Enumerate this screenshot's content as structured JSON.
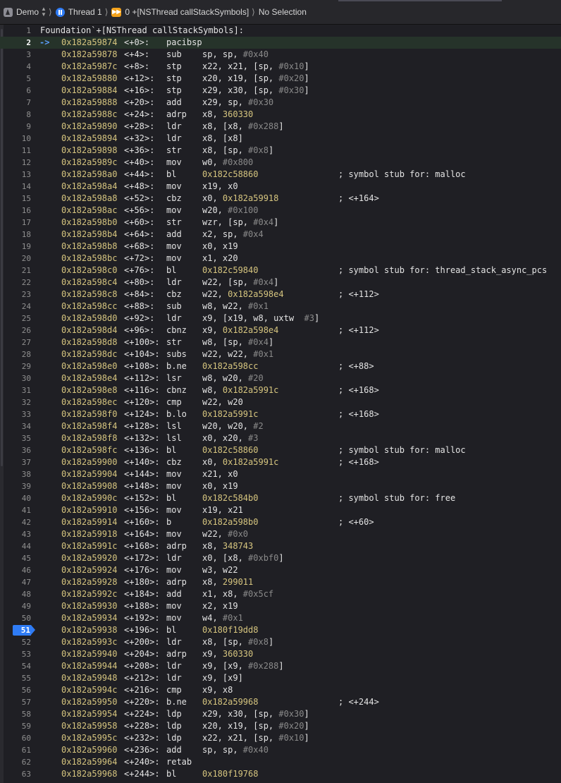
{
  "breadcrumb": {
    "app": "Demo",
    "thread": "Thread 1",
    "frame": "0 +[NSThread callStackSymbols]",
    "selection": "No Selection"
  },
  "disassembly": {
    "function_header": "Foundation`+[NSThread callStackSymbols]:",
    "pc_arrow": "->",
    "current_line": 2,
    "breakpoint_line": 51,
    "lines": [
      {
        "n": "1",
        "header": true
      },
      {
        "n": "2",
        "addr": "0x182a59874",
        "off": "<+0>:",
        "mn": "pacibsp",
        "ops": []
      },
      {
        "n": "3",
        "addr": "0x182a59878",
        "off": "<+4>:",
        "mn": "sub",
        "ops": [
          [
            "sp, sp, ",
            ""
          ],
          [
            "#0x40",
            "imm"
          ]
        ]
      },
      {
        "n": "4",
        "addr": "0x182a5987c",
        "off": "<+8>:",
        "mn": "stp",
        "ops": [
          [
            "x22, x21, [sp, ",
            ""
          ],
          [
            "#0x10",
            "imm"
          ],
          [
            "]",
            ""
          ]
        ]
      },
      {
        "n": "5",
        "addr": "0x182a59880",
        "off": "<+12>:",
        "mn": "stp",
        "ops": [
          [
            "x20, x19, [sp, ",
            ""
          ],
          [
            "#0x20",
            "imm"
          ],
          [
            "]",
            ""
          ]
        ]
      },
      {
        "n": "6",
        "addr": "0x182a59884",
        "off": "<+16>:",
        "mn": "stp",
        "ops": [
          [
            "x29, x30, [sp, ",
            ""
          ],
          [
            "#0x30",
            "imm"
          ],
          [
            "]",
            ""
          ]
        ]
      },
      {
        "n": "7",
        "addr": "0x182a59888",
        "off": "<+20>:",
        "mn": "add",
        "ops": [
          [
            "x29, sp, ",
            ""
          ],
          [
            "#0x30",
            "imm"
          ]
        ]
      },
      {
        "n": "8",
        "addr": "0x182a5988c",
        "off": "<+24>:",
        "mn": "adrp",
        "ops": [
          [
            "x8, ",
            ""
          ],
          [
            "360330",
            "sym"
          ]
        ]
      },
      {
        "n": "9",
        "addr": "0x182a59890",
        "off": "<+28>:",
        "mn": "ldr",
        "ops": [
          [
            "x8, [x8, ",
            ""
          ],
          [
            "#0x288",
            "imm"
          ],
          [
            "]",
            ""
          ]
        ]
      },
      {
        "n": "10",
        "addr": "0x182a59894",
        "off": "<+32>:",
        "mn": "ldr",
        "ops": [
          [
            "x8, [x8]",
            ""
          ]
        ]
      },
      {
        "n": "11",
        "addr": "0x182a59898",
        "off": "<+36>:",
        "mn": "str",
        "ops": [
          [
            "x8, [sp, ",
            ""
          ],
          [
            "#0x8",
            "imm"
          ],
          [
            "]",
            ""
          ]
        ]
      },
      {
        "n": "12",
        "addr": "0x182a5989c",
        "off": "<+40>:",
        "mn": "mov",
        "ops": [
          [
            "w0, ",
            ""
          ],
          [
            "#0x800",
            "imm"
          ]
        ]
      },
      {
        "n": "13",
        "addr": "0x182a598a0",
        "off": "<+44>:",
        "mn": "bl",
        "ops": [
          [
            "0x182c58860",
            "sym"
          ]
        ],
        "cm": "; symbol stub for: malloc"
      },
      {
        "n": "14",
        "addr": "0x182a598a4",
        "off": "<+48>:",
        "mn": "mov",
        "ops": [
          [
            "x19, x0",
            ""
          ]
        ]
      },
      {
        "n": "15",
        "addr": "0x182a598a8",
        "off": "<+52>:",
        "mn": "cbz",
        "ops": [
          [
            "x0, ",
            ""
          ],
          [
            "0x182a59918",
            "sym"
          ]
        ],
        "cm": "; <+164>"
      },
      {
        "n": "16",
        "addr": "0x182a598ac",
        "off": "<+56>:",
        "mn": "mov",
        "ops": [
          [
            "w20, ",
            ""
          ],
          [
            "#0x100",
            "imm"
          ]
        ]
      },
      {
        "n": "17",
        "addr": "0x182a598b0",
        "off": "<+60>:",
        "mn": "str",
        "ops": [
          [
            "wzr, [sp, ",
            ""
          ],
          [
            "#0x4",
            "imm"
          ],
          [
            "]",
            ""
          ]
        ]
      },
      {
        "n": "18",
        "addr": "0x182a598b4",
        "off": "<+64>:",
        "mn": "add",
        "ops": [
          [
            "x2, sp, ",
            ""
          ],
          [
            "#0x4",
            "imm"
          ]
        ]
      },
      {
        "n": "19",
        "addr": "0x182a598b8",
        "off": "<+68>:",
        "mn": "mov",
        "ops": [
          [
            "x0, x19",
            ""
          ]
        ]
      },
      {
        "n": "20",
        "addr": "0x182a598bc",
        "off": "<+72>:",
        "mn": "mov",
        "ops": [
          [
            "x1, x20",
            ""
          ]
        ]
      },
      {
        "n": "21",
        "addr": "0x182a598c0",
        "off": "<+76>:",
        "mn": "bl",
        "ops": [
          [
            "0x182c59840",
            "sym"
          ]
        ],
        "cm": "; symbol stub for: thread_stack_async_pcs"
      },
      {
        "n": "22",
        "addr": "0x182a598c4",
        "off": "<+80>:",
        "mn": "ldr",
        "ops": [
          [
            "w22, [sp, ",
            ""
          ],
          [
            "#0x4",
            "imm"
          ],
          [
            "]",
            ""
          ]
        ]
      },
      {
        "n": "23",
        "addr": "0x182a598c8",
        "off": "<+84>:",
        "mn": "cbz",
        "ops": [
          [
            "w22, ",
            ""
          ],
          [
            "0x182a598e4",
            "sym"
          ]
        ],
        "cm": "; <+112>"
      },
      {
        "n": "24",
        "addr": "0x182a598cc",
        "off": "<+88>:",
        "mn": "sub",
        "ops": [
          [
            "w8, w22, ",
            ""
          ],
          [
            "#0x1",
            "imm"
          ]
        ]
      },
      {
        "n": "25",
        "addr": "0x182a598d0",
        "off": "<+92>:",
        "mn": "ldr",
        "ops": [
          [
            "x9, [x19, w8, uxtw  ",
            ""
          ],
          [
            "#3",
            "imm"
          ],
          [
            "]",
            ""
          ]
        ]
      },
      {
        "n": "26",
        "addr": "0x182a598d4",
        "off": "<+96>:",
        "mn": "cbnz",
        "ops": [
          [
            "x9, ",
            ""
          ],
          [
            "0x182a598e4",
            "sym"
          ]
        ],
        "cm": "; <+112>"
      },
      {
        "n": "27",
        "addr": "0x182a598d8",
        "off": "<+100>:",
        "mn": "str",
        "ops": [
          [
            "w8, [sp, ",
            ""
          ],
          [
            "#0x4",
            "imm"
          ],
          [
            "]",
            ""
          ]
        ]
      },
      {
        "n": "28",
        "addr": "0x182a598dc",
        "off": "<+104>:",
        "mn": "subs",
        "ops": [
          [
            "w22, w22, ",
            ""
          ],
          [
            "#0x1",
            "imm"
          ]
        ]
      },
      {
        "n": "29",
        "addr": "0x182a598e0",
        "off": "<+108>:",
        "mn": "b.ne",
        "ops": [
          [
            "0x182a598cc",
            "sym"
          ]
        ],
        "cm": "; <+88>"
      },
      {
        "n": "30",
        "addr": "0x182a598e4",
        "off": "<+112>:",
        "mn": "lsr",
        "ops": [
          [
            "w8, w20, ",
            ""
          ],
          [
            "#20",
            "imm"
          ]
        ]
      },
      {
        "n": "31",
        "addr": "0x182a598e8",
        "off": "<+116>:",
        "mn": "cbnz",
        "ops": [
          [
            "w8, ",
            ""
          ],
          [
            "0x182a5991c",
            "sym"
          ]
        ],
        "cm": "; <+168>"
      },
      {
        "n": "32",
        "addr": "0x182a598ec",
        "off": "<+120>:",
        "mn": "cmp",
        "ops": [
          [
            "w22, w20",
            ""
          ]
        ]
      },
      {
        "n": "33",
        "addr": "0x182a598f0",
        "off": "<+124>:",
        "mn": "b.lo",
        "ops": [
          [
            "0x182a5991c",
            "sym"
          ]
        ],
        "cm": "; <+168>"
      },
      {
        "n": "34",
        "addr": "0x182a598f4",
        "off": "<+128>:",
        "mn": "lsl",
        "ops": [
          [
            "w20, w20, ",
            ""
          ],
          [
            "#2",
            "imm"
          ]
        ]
      },
      {
        "n": "35",
        "addr": "0x182a598f8",
        "off": "<+132>:",
        "mn": "lsl",
        "ops": [
          [
            "x0, x20, ",
            ""
          ],
          [
            "#3",
            "imm"
          ]
        ]
      },
      {
        "n": "36",
        "addr": "0x182a598fc",
        "off": "<+136>:",
        "mn": "bl",
        "ops": [
          [
            "0x182c58860",
            "sym"
          ]
        ],
        "cm": "; symbol stub for: malloc"
      },
      {
        "n": "37",
        "addr": "0x182a59900",
        "off": "<+140>:",
        "mn": "cbz",
        "ops": [
          [
            "x0, ",
            ""
          ],
          [
            "0x182a5991c",
            "sym"
          ]
        ],
        "cm": "; <+168>"
      },
      {
        "n": "38",
        "addr": "0x182a59904",
        "off": "<+144>:",
        "mn": "mov",
        "ops": [
          [
            "x21, x0",
            ""
          ]
        ]
      },
      {
        "n": "39",
        "addr": "0x182a59908",
        "off": "<+148>:",
        "mn": "mov",
        "ops": [
          [
            "x0, x19",
            ""
          ]
        ]
      },
      {
        "n": "40",
        "addr": "0x182a5990c",
        "off": "<+152>:",
        "mn": "bl",
        "ops": [
          [
            "0x182c584b0",
            "sym"
          ]
        ],
        "cm": "; symbol stub for: free"
      },
      {
        "n": "41",
        "addr": "0x182a59910",
        "off": "<+156>:",
        "mn": "mov",
        "ops": [
          [
            "x19, x21",
            ""
          ]
        ]
      },
      {
        "n": "42",
        "addr": "0x182a59914",
        "off": "<+160>:",
        "mn": "b",
        "ops": [
          [
            "0x182a598b0",
            "sym"
          ]
        ],
        "cm": "; <+60>"
      },
      {
        "n": "43",
        "addr": "0x182a59918",
        "off": "<+164>:",
        "mn": "mov",
        "ops": [
          [
            "w22, ",
            ""
          ],
          [
            "#0x0",
            "imm"
          ]
        ]
      },
      {
        "n": "44",
        "addr": "0x182a5991c",
        "off": "<+168>:",
        "mn": "adrp",
        "ops": [
          [
            "x8, ",
            ""
          ],
          [
            "348743",
            "sym"
          ]
        ]
      },
      {
        "n": "45",
        "addr": "0x182a59920",
        "off": "<+172>:",
        "mn": "ldr",
        "ops": [
          [
            "x0, [x8, ",
            ""
          ],
          [
            "#0xbf0",
            "imm"
          ],
          [
            "]",
            ""
          ]
        ]
      },
      {
        "n": "46",
        "addr": "0x182a59924",
        "off": "<+176>:",
        "mn": "mov",
        "ops": [
          [
            "w3, w22",
            ""
          ]
        ]
      },
      {
        "n": "47",
        "addr": "0x182a59928",
        "off": "<+180>:",
        "mn": "adrp",
        "ops": [
          [
            "x8, ",
            ""
          ],
          [
            "299011",
            "sym"
          ]
        ]
      },
      {
        "n": "48",
        "addr": "0x182a5992c",
        "off": "<+184>:",
        "mn": "add",
        "ops": [
          [
            "x1, x8, ",
            ""
          ],
          [
            "#0x5cf",
            "imm"
          ]
        ]
      },
      {
        "n": "49",
        "addr": "0x182a59930",
        "off": "<+188>:",
        "mn": "mov",
        "ops": [
          [
            "x2, x19",
            ""
          ]
        ]
      },
      {
        "n": "50",
        "addr": "0x182a59934",
        "off": "<+192>:",
        "mn": "mov",
        "ops": [
          [
            "w4, ",
            ""
          ],
          [
            "#0x1",
            "imm"
          ]
        ]
      },
      {
        "n": "51",
        "addr": "0x182a59938",
        "off": "<+196>:",
        "mn": "bl",
        "ops": [
          [
            "0x180f19dd8",
            "sym"
          ]
        ]
      },
      {
        "n": "52",
        "addr": "0x182a5993c",
        "off": "<+200>:",
        "mn": "ldr",
        "ops": [
          [
            "x8, [sp, ",
            ""
          ],
          [
            "#0x8",
            "imm"
          ],
          [
            "]",
            ""
          ]
        ]
      },
      {
        "n": "53",
        "addr": "0x182a59940",
        "off": "<+204>:",
        "mn": "adrp",
        "ops": [
          [
            "x9, ",
            ""
          ],
          [
            "360330",
            "sym"
          ]
        ]
      },
      {
        "n": "54",
        "addr": "0x182a59944",
        "off": "<+208>:",
        "mn": "ldr",
        "ops": [
          [
            "x9, [x9, ",
            ""
          ],
          [
            "#0x288",
            "imm"
          ],
          [
            "]",
            ""
          ]
        ]
      },
      {
        "n": "55",
        "addr": "0x182a59948",
        "off": "<+212>:",
        "mn": "ldr",
        "ops": [
          [
            "x9, [x9]",
            ""
          ]
        ]
      },
      {
        "n": "56",
        "addr": "0x182a5994c",
        "off": "<+216>:",
        "mn": "cmp",
        "ops": [
          [
            "x9, x8",
            ""
          ]
        ]
      },
      {
        "n": "57",
        "addr": "0x182a59950",
        "off": "<+220>:",
        "mn": "b.ne",
        "ops": [
          [
            "0x182a59968",
            "sym"
          ]
        ],
        "cm": "; <+244>"
      },
      {
        "n": "58",
        "addr": "0x182a59954",
        "off": "<+224>:",
        "mn": "ldp",
        "ops": [
          [
            "x29, x30, [sp, ",
            ""
          ],
          [
            "#0x30",
            "imm"
          ],
          [
            "]",
            ""
          ]
        ]
      },
      {
        "n": "59",
        "addr": "0x182a59958",
        "off": "<+228>:",
        "mn": "ldp",
        "ops": [
          [
            "x20, x19, [sp, ",
            ""
          ],
          [
            "#0x20",
            "imm"
          ],
          [
            "]",
            ""
          ]
        ]
      },
      {
        "n": "60",
        "addr": "0x182a5995c",
        "off": "<+232>:",
        "mn": "ldp",
        "ops": [
          [
            "x22, x21, [sp, ",
            ""
          ],
          [
            "#0x10",
            "imm"
          ],
          [
            "]",
            ""
          ]
        ]
      },
      {
        "n": "61",
        "addr": "0x182a59960",
        "off": "<+236>:",
        "mn": "add",
        "ops": [
          [
            "sp, sp, ",
            ""
          ],
          [
            "#0x40",
            "imm"
          ]
        ]
      },
      {
        "n": "62",
        "addr": "0x182a59964",
        "off": "<+240>:",
        "mn": "retab",
        "ops": []
      },
      {
        "n": "63",
        "addr": "0x182a59968",
        "off": "<+244>:",
        "mn": "bl",
        "ops": [
          [
            "0x180f19768",
            "sym"
          ]
        ]
      }
    ]
  }
}
